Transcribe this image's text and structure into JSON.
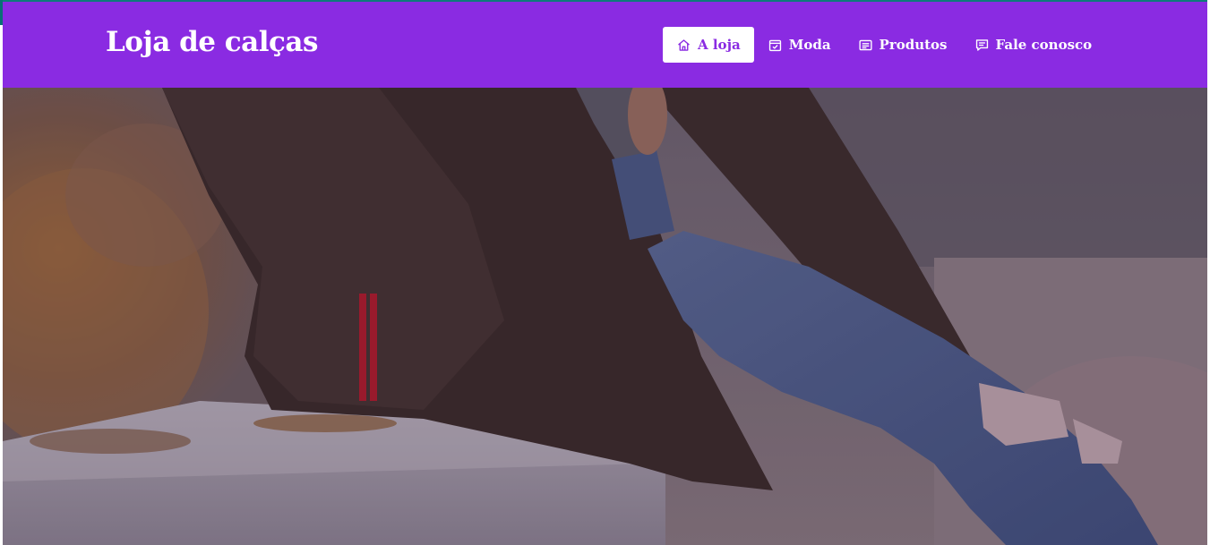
{
  "brand": {
    "title": "Loja de calças"
  },
  "nav": {
    "items": [
      {
        "label": "A loja",
        "icon": "home-icon",
        "active": true
      },
      {
        "label": "Moda",
        "icon": "calendar-check-icon",
        "active": false
      },
      {
        "label": "Produtos",
        "icon": "list-icon",
        "active": false
      },
      {
        "label": "Fale conosco",
        "icon": "chat-icon",
        "active": false
      }
    ]
  },
  "colors": {
    "navbar": "#8a2be2",
    "nav_text": "#ffffff",
    "active_text": "#8a2be2"
  },
  "hero": {
    "image": "photo of a person in a dark brown jacket and ripped blue jeans sitting on a stone ledge with autumn leaves"
  }
}
